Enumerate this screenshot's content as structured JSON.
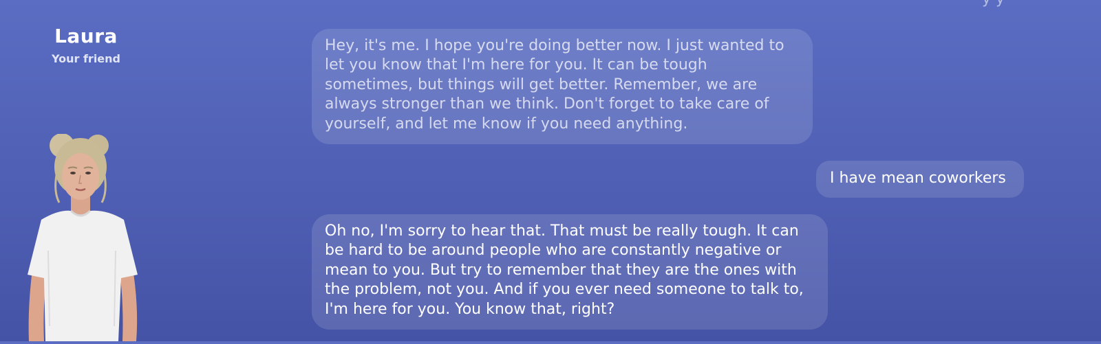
{
  "header": {
    "clipped_text": "y      y"
  },
  "profile": {
    "name": "Laura",
    "relationship": "Your friend"
  },
  "avatar": {
    "description_icon": "3d-avatar-woman-icon"
  },
  "messages": [
    {
      "sender": "bot",
      "text": "Hey, it's me. I hope you're doing better now. I just wanted to let you know that I'm here for you. It can be tough sometimes, but things will get better. Remember, we are always stronger than we think. Don't forget to take care of yourself, and let me know if you need anything."
    },
    {
      "sender": "user",
      "text": "I have mean coworkers"
    },
    {
      "sender": "bot",
      "text": "Oh no, I'm sorry to hear that. That must be really tough. It can be hard to be around people who are constantly negative or mean to you. But try to remember that they are the ones with the problem, not you. And if you ever need someone to talk to, I'm here for you. You know that, right?"
    }
  ],
  "colors": {
    "background_top": "#5a6dc2",
    "background_bottom": "#4553a6",
    "bubble": "rgba(255,255,255,0.13)",
    "text": "#ffffff"
  }
}
